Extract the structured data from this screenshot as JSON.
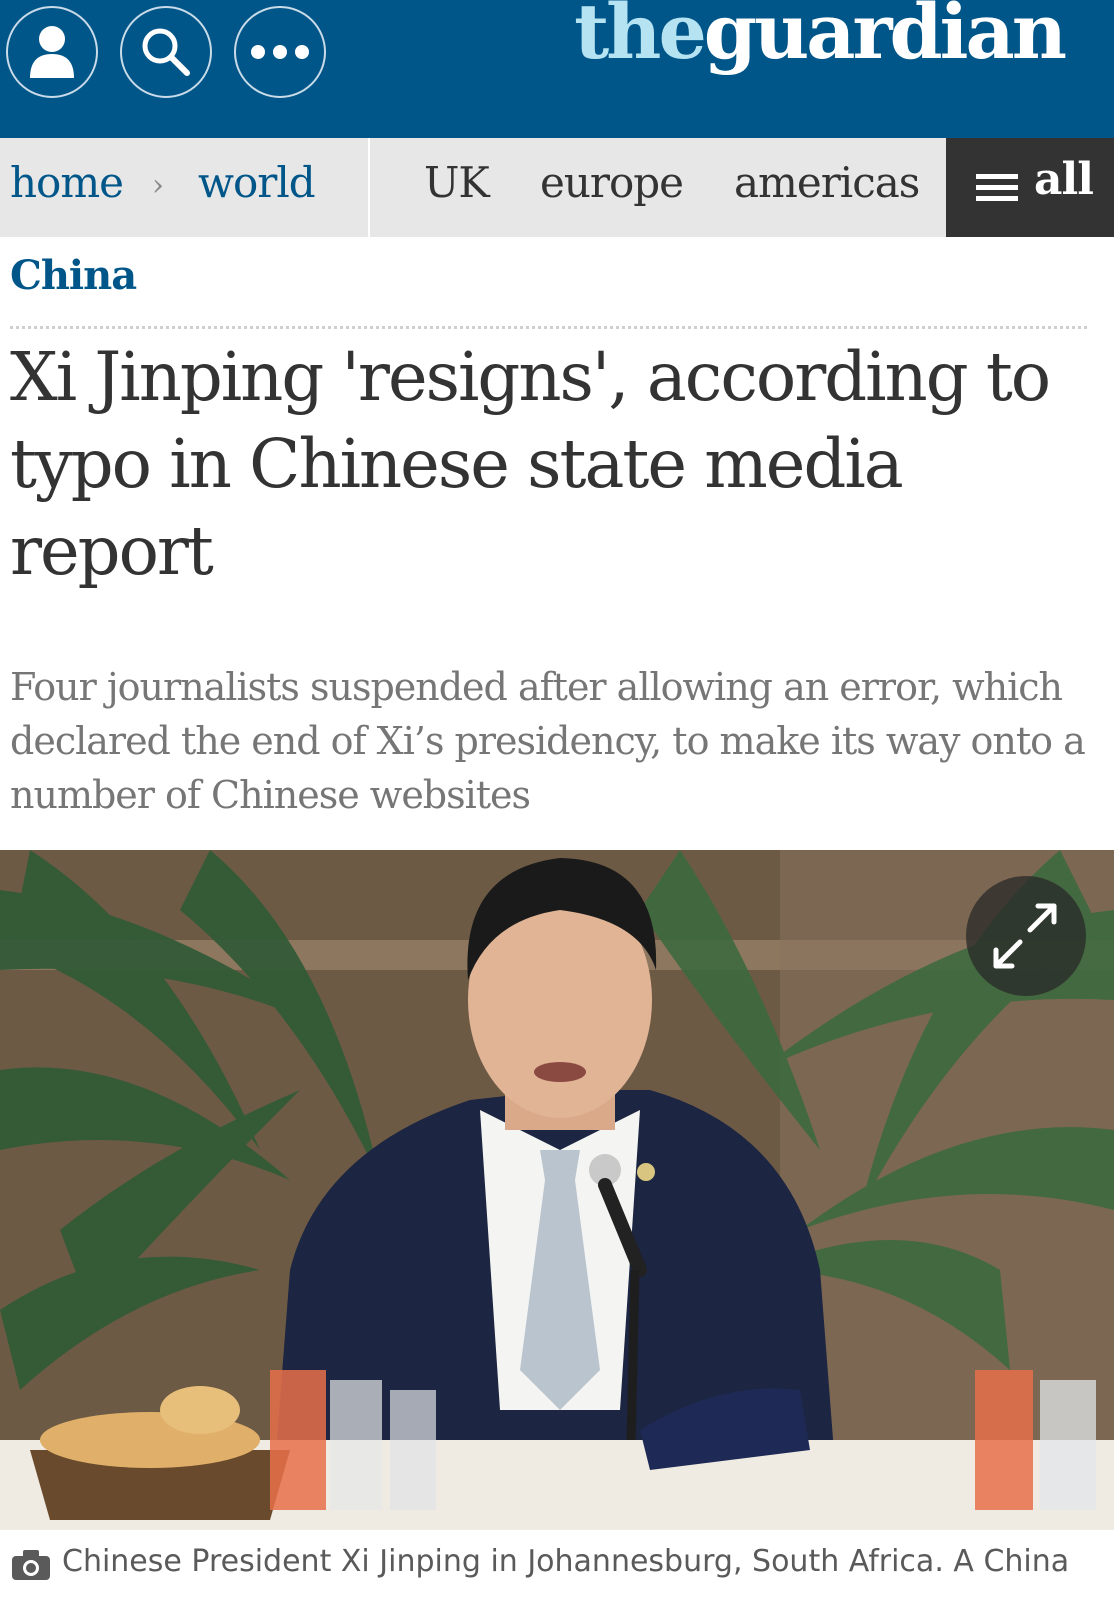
{
  "header": {
    "logo_prefix": "the",
    "logo_brand": "guardian",
    "profile_icon": "user-icon",
    "search_icon": "search-icon",
    "more_icon": "more-icon",
    "background_color": "#005689"
  },
  "nav": {
    "home": "home",
    "separator": "›",
    "world": "world",
    "items": [
      "UK",
      "europe",
      "americas"
    ],
    "all_label": "all"
  },
  "article": {
    "section": "China",
    "headline": "Xi Jinping 'resigns', according to typo in Chinese state media report",
    "standfirst": "Four journalists suspended after allowing an error, which declared the end of Xi’s presidency, to make its way onto a number of Chinese websites",
    "caption": "Chinese President Xi Jinping in Johannesburg, South Africa. A China",
    "photo_alt": "Chinese President Xi Jinping speaking at a table with breakfast items and palm plants behind"
  },
  "icons": {
    "expand": "expand-icon",
    "camera": "camera-icon"
  }
}
